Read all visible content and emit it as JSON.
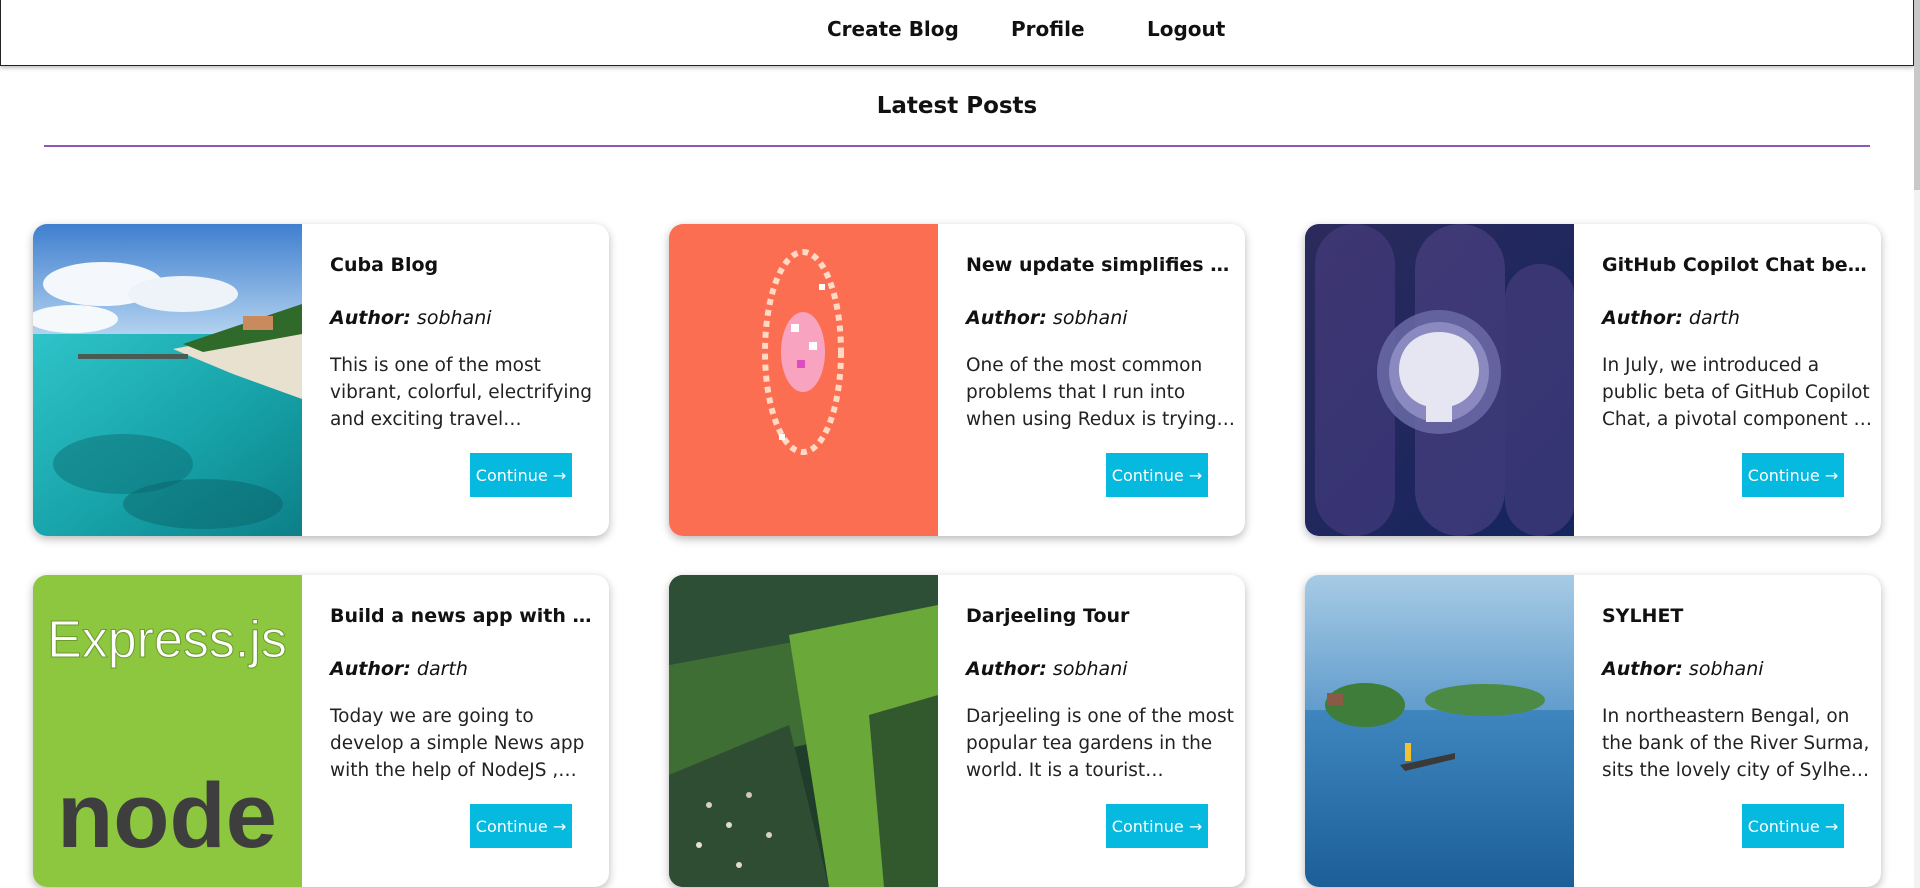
{
  "nav": {
    "create_blog": "Create Blog",
    "profile": "Profile",
    "logout": "Logout"
  },
  "latest_posts_title": "Latest Posts",
  "author_label": "Author:",
  "continue_label": "Continue →",
  "posts": [
    {
      "title": "Cuba Blog",
      "author": "sobhani",
      "excerpt": "This is one of the most vibrant, colorful, electrifying and exciting travel destinations on…",
      "image": "tropical-beach-image"
    },
    {
      "title": "New update simplifies React",
      "author": "sobhani",
      "excerpt": "One of the most common problems that I run into when using Redux is trying to figur…",
      "image": "react-logo-pixel-art-image"
    },
    {
      "title": "GitHub Copilot Chat beta…",
      "author": "darth",
      "excerpt": "In July, we introduced a public beta of GitHub Copilot Chat, a pivotal component of our…",
      "image": "github-logo-image"
    },
    {
      "title": "Build a news app with Nod…",
      "author": "darth",
      "excerpt": "Today we are going to develop a simple News app with the help of NodeJS , Express , EJS…",
      "image": "express-node-logo-image",
      "image_text_top": "Express.js",
      "image_text_bottom": "node"
    },
    {
      "title": "Darjeeling Tour",
      "author": "sobhani",
      "excerpt": "Darjeeling is one of the most popular tea gardens in the world. It is a tourist destinatio…",
      "image": "hillside-town-image"
    },
    {
      "title": "SYLHET",
      "author": "sobhani",
      "excerpt": "In northeastern Bengal, on the bank of the River Surma, sits the lovely city of Sylhet in…",
      "image": "river-boat-image"
    }
  ],
  "colors": {
    "accent_button": "#05b9df",
    "divider": "#8e58b8"
  }
}
